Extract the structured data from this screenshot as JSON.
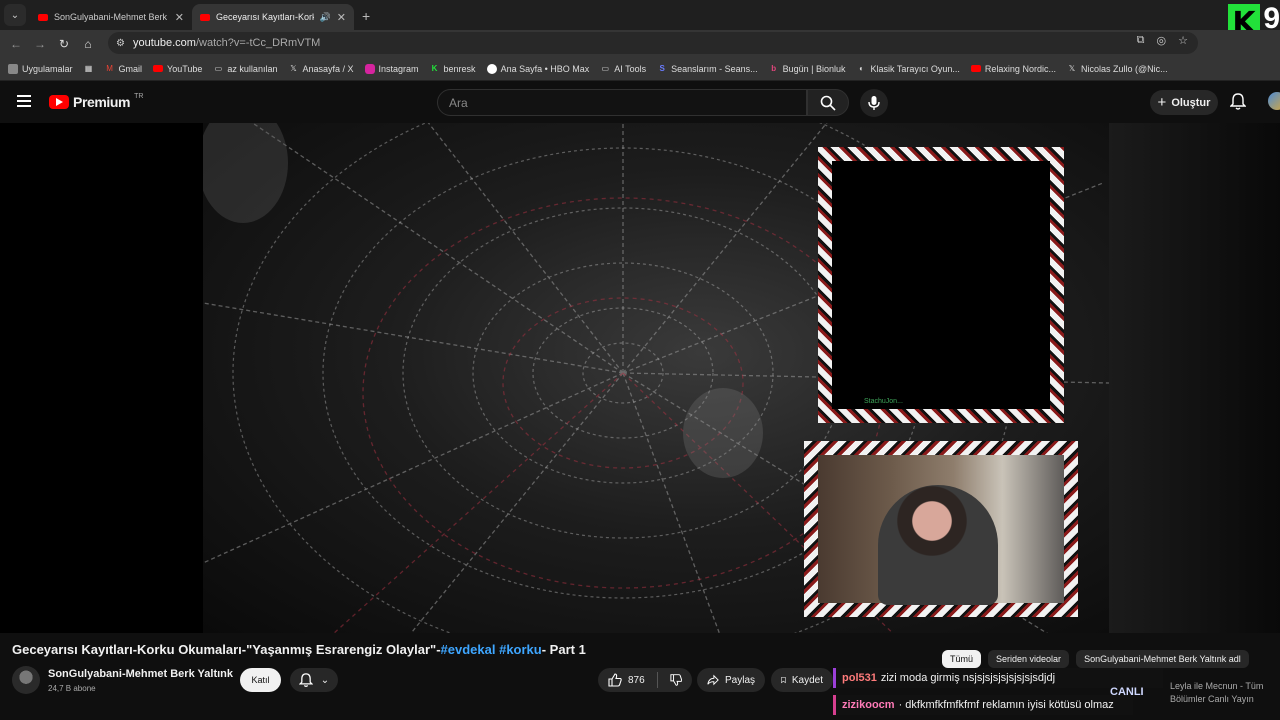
{
  "browser": {
    "tabs": [
      {
        "title": "SonGulyabani-Mehmet Berk Ya",
        "active": false
      },
      {
        "title": "Geceyarısı Kayıtları-Korku O",
        "active": true
      }
    ],
    "url_host": "youtube.com",
    "url_path": "/watch?v=-tCc_DRmVTM",
    "bookmarks": [
      "Uygulamalar",
      "Gmail",
      "YouTube",
      "az kullanılan",
      "Anasayfa / X",
      "Instagram",
      "benresk",
      "Ana Sayfa • HBO Max",
      "AI Tools",
      "Seanslarım - Seans...",
      "Bugün | Bionluk",
      "Klasik Tarayıcı Oyun...",
      "Relaxing Nordic...",
      "Nicolas Zullo (@Nic..."
    ],
    "ext_letter": "K",
    "ext_number": "9"
  },
  "masthead": {
    "logo_text": "Premium",
    "logo_region": "TR",
    "search_placeholder": "Ara",
    "create_label": "Oluştur"
  },
  "player": {
    "cam_username": "StachuJon..."
  },
  "video": {
    "title_main": "Geceyarısı Kayıtları-Korku Okumaları-\"Yaşanmış Esrarengiz Olaylar\"-",
    "tag1": "#evdekal",
    "tag2": "#korku",
    "title_end": "- Part 1",
    "channel_name": "SonGulyabani-Mehmet Berk Yaltınk",
    "subscribers": "24,7 B abone",
    "join_label": "Katıl",
    "likes": "876",
    "share_label": "Paylaş",
    "save_label": "Kaydet"
  },
  "chips": [
    "Tümü",
    "Seriden videolar",
    "SonGulyabani-Mehmet Berk Yaltınk adl"
  ],
  "overlay_chat": [
    {
      "user": "pol531",
      "message": "zizi moda girmiş nsjsjsjsjsjsjsjsjsdjdj"
    },
    {
      "user": "zizikoocm",
      "message": "· dkfkmfkfmfkfmf reklamın iyisi kötüsü olmaz"
    }
  ],
  "live_badge": "CANLI",
  "recommendation": "Leyla ile Mecnun - Tüm Bölümler Canlı Yayın"
}
